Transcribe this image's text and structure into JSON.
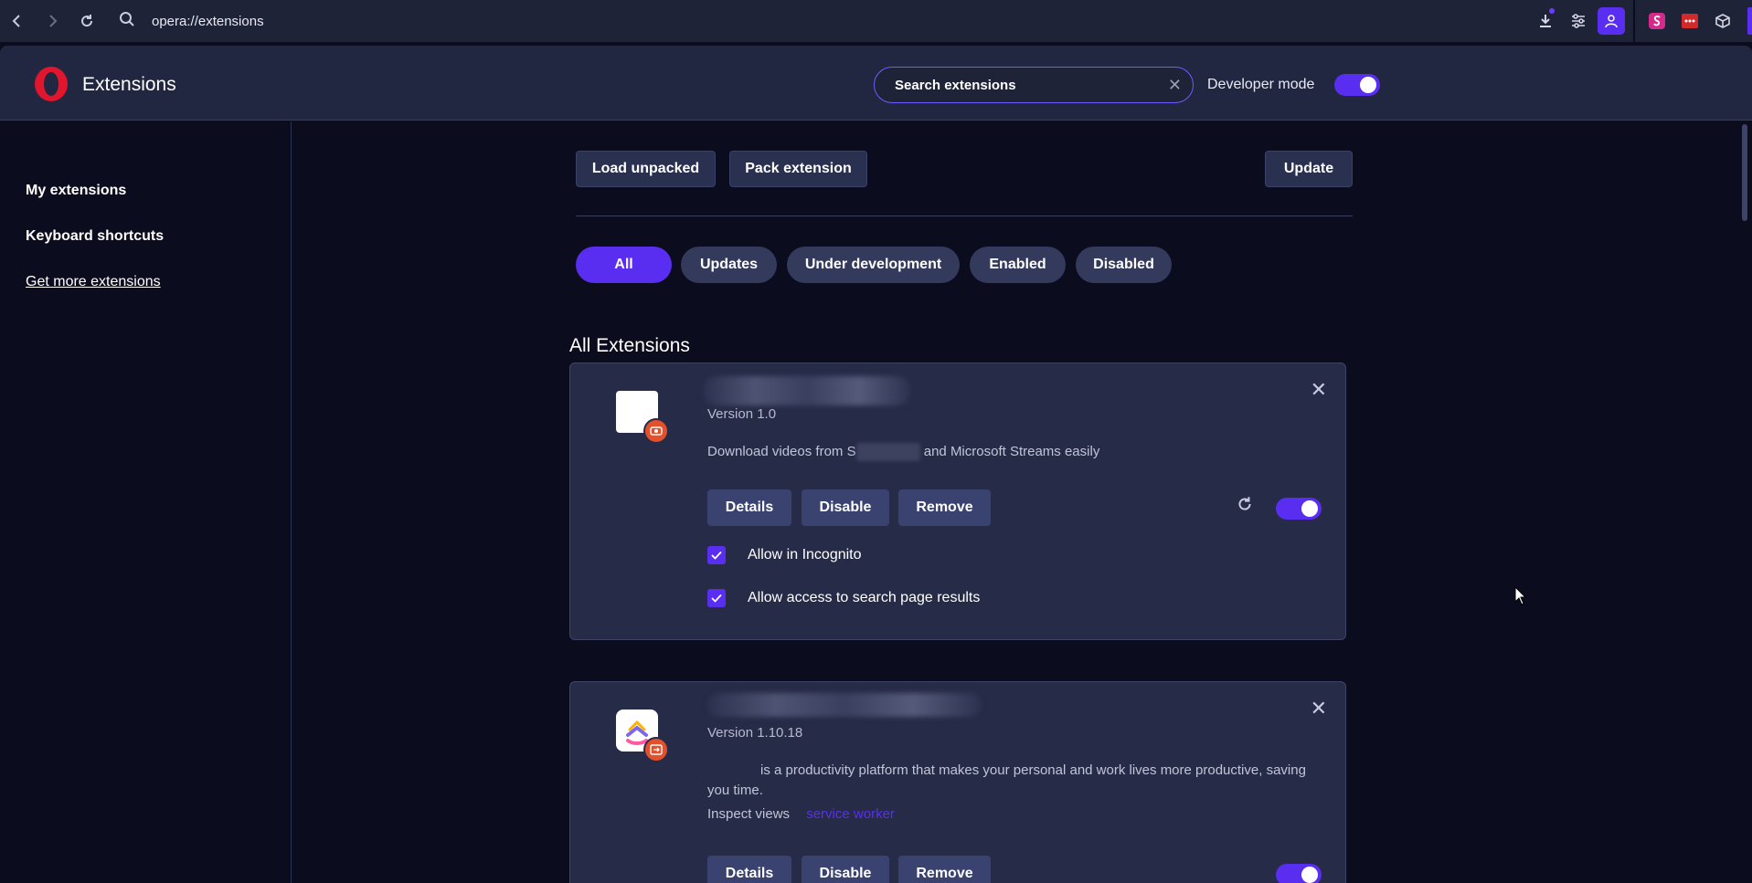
{
  "browser": {
    "url": "opera://extensions"
  },
  "header": {
    "title": "Extensions",
    "search_placeholder": "Search extensions",
    "developer_mode_label": "Developer mode",
    "developer_mode_on": true
  },
  "sidebar": {
    "items": [
      {
        "label": "My extensions"
      },
      {
        "label": "Keyboard shortcuts"
      },
      {
        "label": "Get more extensions"
      }
    ]
  },
  "toolbar": {
    "load_unpacked": "Load unpacked",
    "pack_extension": "Pack extension",
    "update": "Update"
  },
  "filters": [
    {
      "label": "All",
      "active": true
    },
    {
      "label": "Updates",
      "active": false
    },
    {
      "label": "Under development",
      "active": false
    },
    {
      "label": "Enabled",
      "active": false
    },
    {
      "label": "Disabled",
      "active": false
    }
  ],
  "section_title": "All Extensions",
  "extensions": [
    {
      "version": "Version 1.0",
      "description_before": "Download videos from S",
      "description_after": " and Microsoft Streams easily",
      "details": "Details",
      "disable": "Disable",
      "remove": "Remove",
      "enabled": true,
      "checkboxes": [
        {
          "label": "Allow in Incognito",
          "checked": true
        },
        {
          "label": "Allow access to search page results",
          "checked": true
        }
      ]
    },
    {
      "version": "Version 1.10.18",
      "description": "is a productivity platform that makes your personal and work lives more productive, saving you time.",
      "inspect_label": "Inspect views",
      "inspect_link": "service worker",
      "details": "Details",
      "disable": "Disable",
      "remove": "Remove",
      "enabled": true
    }
  ],
  "colors": {
    "accent": "#5a2ef0",
    "background": "#0b0c1e",
    "card": "#262b47",
    "opera_red": "#e0152e"
  }
}
